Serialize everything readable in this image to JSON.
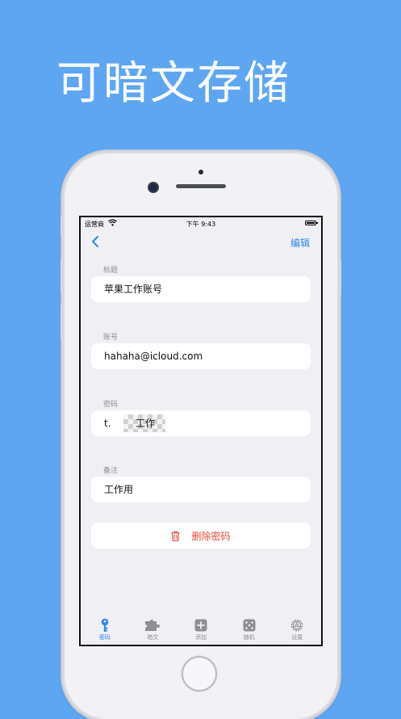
{
  "headline": "可暗文存储",
  "status_bar": {
    "carrier": "运营商",
    "time": "下午 9:43"
  },
  "nav": {
    "back_icon": "chevron-left-icon",
    "edit_label": "编辑"
  },
  "fields": [
    {
      "label": "标题",
      "value": "苹果工作账号"
    },
    {
      "label": "账号",
      "value": "hahaha@icloud.com"
    },
    {
      "label": "密码",
      "value_prefix": "t.",
      "value_suffix": "工作"
    },
    {
      "label": "备注",
      "value": "工作用"
    }
  ],
  "delete": {
    "icon": "trash-icon",
    "label": "删除密码"
  },
  "tabs": [
    {
      "label": "密码",
      "icon": "key-icon",
      "active": true
    },
    {
      "label": "暗文",
      "icon": "puzzle-icon",
      "active": false
    },
    {
      "label": "添加",
      "icon": "plus-square-icon",
      "active": false
    },
    {
      "label": "随机",
      "icon": "dice-icon",
      "active": false
    },
    {
      "label": "设置",
      "icon": "gear-icon",
      "active": false
    }
  ],
  "colors": {
    "background": "#5fa6f2",
    "accent": "#2f86e8",
    "destructive": "#e8483b",
    "screen_bg": "#efeff4"
  }
}
